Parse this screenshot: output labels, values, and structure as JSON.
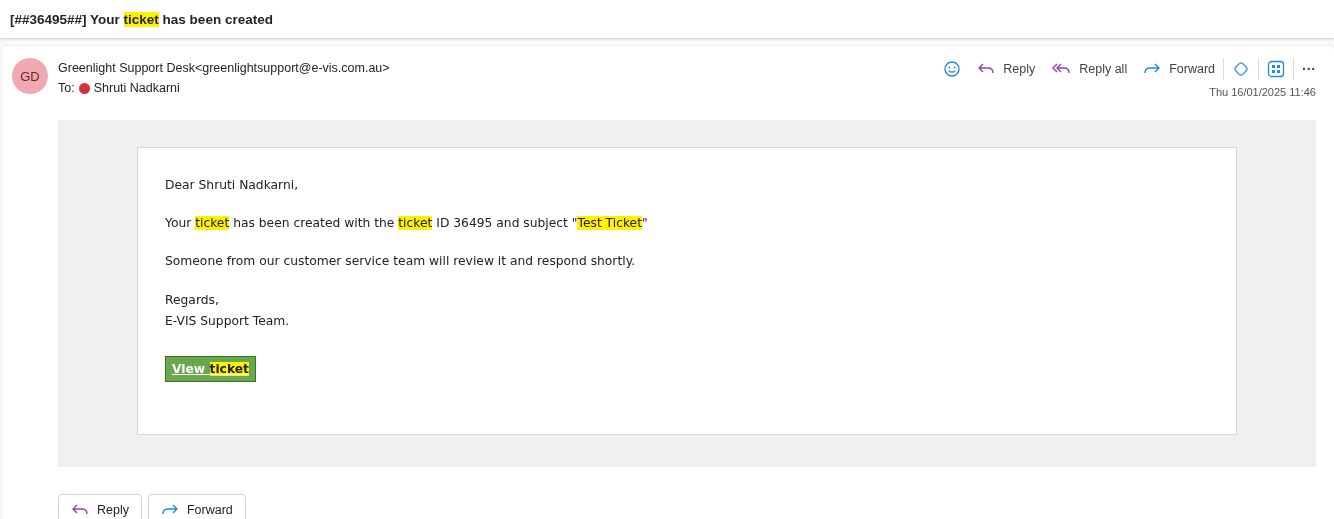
{
  "subject": [
    {
      "text": "[##36495##] Your ",
      "highlight": false
    },
    {
      "text": "ticket",
      "highlight": true
    },
    {
      "text": " has been created",
      "highlight": false
    }
  ],
  "message": {
    "avatar": "GD",
    "sender": "Greenlight Support Desk<greenlightsupport@e-vis.com.au>",
    "to_label": "To:",
    "recipient": "Shruti Nadkarni",
    "date": "Thu 16/01/2025 11:46",
    "actions": [
      {
        "kind": "emoji"
      },
      {
        "kind": "reply",
        "label": "Reply"
      },
      {
        "kind": "reply_all",
        "label": "Reply all"
      },
      {
        "kind": "forward",
        "label": "Forward"
      },
      {
        "kind": "copilot"
      },
      {
        "kind": "apps"
      },
      {
        "kind": "more",
        "label": "···"
      }
    ]
  },
  "body": {
    "paragraphs": [
      [
        {
          "text": "Dear Shruti Nadkarni,",
          "highlight": false
        }
      ],
      [
        {
          "text": "Your ",
          "highlight": false
        },
        {
          "text": "ticket",
          "highlight": true
        },
        {
          "text": " has been created with the ",
          "highlight": false
        },
        {
          "text": "ticket",
          "highlight": true
        },
        {
          "text": " ID 36495 and subject \"",
          "highlight": false
        },
        {
          "text": "Test Ticket",
          "highlight": true
        },
        {
          "text": "\"",
          "highlight": false
        }
      ],
      [
        {
          "text": "Someone from our customer service team will review it and respond shortly.",
          "highlight": false
        }
      ],
      [
        {
          "text": "Regards,",
          "highlight": false
        }
      ],
      [
        {
          "text": "E-VIS Support Team.",
          "highlight": false
        }
      ]
    ],
    "button": [
      {
        "text": "View ",
        "highlight": false
      },
      {
        "text": "ticket",
        "highlight": true
      }
    ]
  },
  "footer_buttons": [
    {
      "kind": "reply",
      "label": "Reply"
    },
    {
      "kind": "forward",
      "label": "Forward"
    }
  ]
}
